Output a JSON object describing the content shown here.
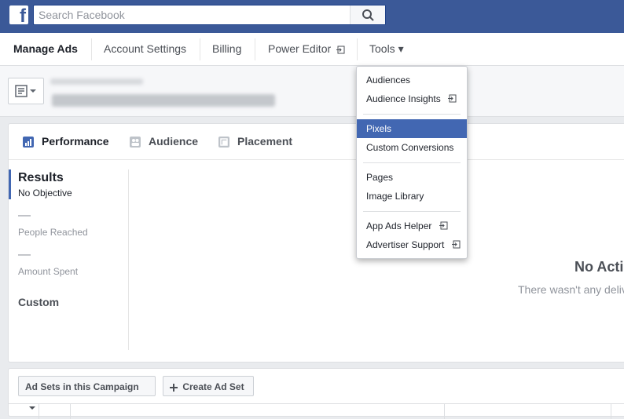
{
  "header": {
    "logo_letter": "f",
    "search_placeholder": "Search Facebook",
    "brand_color": "#3b5998"
  },
  "nav": {
    "items": [
      {
        "label": "Manage Ads",
        "active": true
      },
      {
        "label": "Account Settings"
      },
      {
        "label": "Billing"
      },
      {
        "label": "Power Editor",
        "icon": "external-link-icon"
      },
      {
        "label": "Tools",
        "icon": "caret-down-icon",
        "caret": "▾"
      }
    ]
  },
  "tabs": [
    {
      "label": "Performance",
      "icon": "bar-chart-icon",
      "active": true
    },
    {
      "label": "Audience",
      "icon": "people-icon"
    },
    {
      "label": "Placement",
      "icon": "placement-icon"
    }
  ],
  "results": {
    "title": "Results",
    "objective": "No Objective",
    "reached_value": "—",
    "reached_label": "People Reached",
    "spent_value": "—",
    "spent_label": "Amount Spent",
    "custom_label": "Custom"
  },
  "empty_state": {
    "title": "No Acti",
    "subtitle": "There wasn't any deliv"
  },
  "bottom": {
    "adsets_button": "Ad Sets in this Campaign",
    "create_button": "Create Ad Set"
  },
  "tools_menu": {
    "groups": [
      [
        {
          "label": "Audiences"
        },
        {
          "label": "Audience Insights",
          "external": true
        }
      ],
      [
        {
          "label": "Pixels",
          "highlighted": true
        },
        {
          "label": "Custom Conversions"
        }
      ],
      [
        {
          "label": "Pages"
        },
        {
          "label": "Image Library"
        }
      ],
      [
        {
          "label": "App Ads Helper",
          "external": true
        },
        {
          "label": "Advertiser Support",
          "external": true
        }
      ]
    ],
    "highlight_color": "#4267b2"
  }
}
